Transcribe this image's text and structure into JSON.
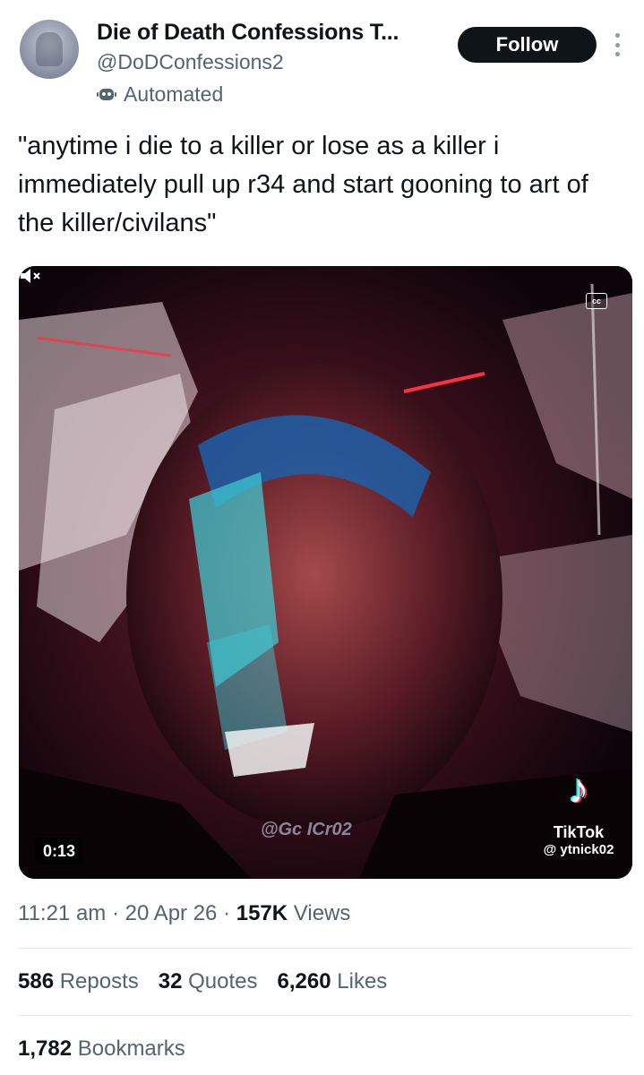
{
  "author": {
    "display_name": "Die of Death Confessions T...",
    "handle": "@DoDConfessions2",
    "label": "Automated",
    "label_icon": "bot-icon"
  },
  "actions": {
    "follow_label": "Follow",
    "more_icon": "more-vertical-icon"
  },
  "tweet": {
    "text": "\"anytime i die to a killer or lose as a killer i immediately pull up r34 and start gooning to art of the killer/civilans\""
  },
  "media": {
    "type": "video",
    "captions_label": "cc",
    "duration": "0:13",
    "watermark_text": "@Gc    ICr02",
    "tiktok_name": "TikTok",
    "tiktok_handle": "@ ytnick02",
    "tiktok_icon": "tiktok-logo-icon",
    "mute_icon": "speaker-muted-icon"
  },
  "meta": {
    "time": "11:21 am",
    "separator": "·",
    "date": "20 Apr 26",
    "views_count": "157K",
    "views_label": "Views"
  },
  "engagement": {
    "reposts_count": "586",
    "reposts_label": "Reposts",
    "quotes_count": "32",
    "quotes_label": "Quotes",
    "likes_count": "6,260",
    "likes_label": "Likes",
    "bookmarks_count": "1,782",
    "bookmarks_label": "Bookmarks"
  },
  "colors": {
    "text_primary": "#0f1419",
    "text_secondary": "#536471",
    "divider": "#e6ecf0",
    "follow_bg": "#0f1419"
  }
}
